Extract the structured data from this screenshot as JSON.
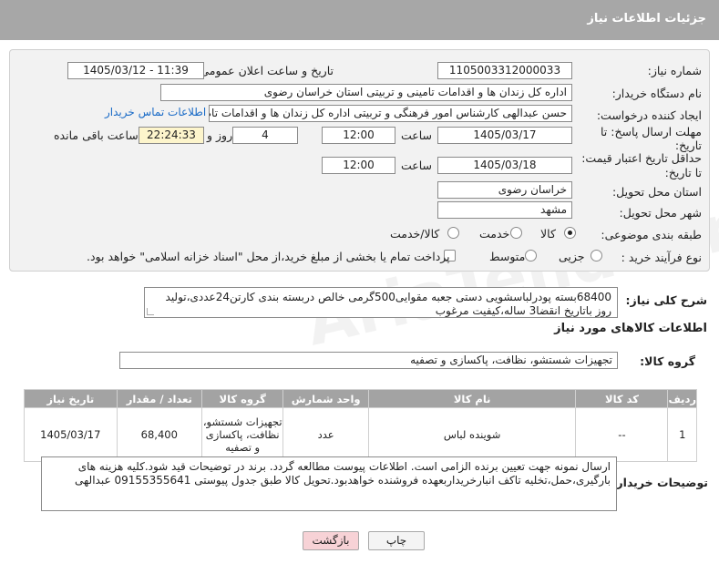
{
  "header": {
    "title": "جزئیات اطلاعات نیاز"
  },
  "form": {
    "need_number_label": "شماره نیاز:",
    "need_number": "1105003312000033",
    "announce_label": "تاریخ و ساعت اعلان عمومی:",
    "announce_value": "1405/03/12 - 11:39",
    "buyer_org_label": "نام دستگاه خریدار:",
    "buyer_org": "اداره کل زندان ها و اقدامات تامینی و تربیتی استان خراسان رضوی",
    "requester_label": "ایجاد کننده درخواست:",
    "requester": "حسن عبدالهی کارشناس امور فرهنگی و تربیتی اداره کل زندان ها و اقدامات تام",
    "contact_link": "اطلاعات تماس خریدار",
    "deadline_label_1": "مهلت ارسال پاسخ: تا",
    "deadline_label_2": "تاریخ:",
    "deadline_date": "1405/03/17",
    "time_label": "ساعت",
    "deadline_time": "12:00",
    "days_value": "4",
    "days_label": "روز و",
    "remaining_time": "22:24:33",
    "remaining_label": "ساعت باقی مانده",
    "validity_label_1": "حداقل تاریخ اعتبار قیمت:",
    "validity_label_2": "تا تاریخ:",
    "validity_date": "1405/03/18",
    "validity_time": "12:00",
    "province_label": "استان محل تحویل:",
    "province": "خراسان رضوی",
    "city_label": "شهر محل تحویل:",
    "city": "مشهد",
    "category_label": "طبقه بندی موضوعی:",
    "category_options": [
      "کالا",
      "خدمت",
      "کالا/خدمت"
    ],
    "category_selected": "کالا",
    "process_label": "نوع فرآیند خرید :",
    "process_options": [
      "جزیی",
      "متوسط"
    ],
    "process_selected": "",
    "payment_note": "پرداخت تمام یا بخشی از مبلغ خرید،از محل \"اسناد خزانه اسلامی\" خواهد بود."
  },
  "description": {
    "label": "شرح کلی نیاز:",
    "text": "68400بسته پودرلباسشویی دستی جعبه مقوایی500گرمی خالص دربسته بندی کارتن24عددی،تولید روز باتاریخ انقضا3 ساله،کیفیت مرغوب"
  },
  "goods_section": {
    "title": "اطلاعات کالاهای مورد نیاز",
    "group_label": "گروه کالا:",
    "group_value": "تجهیزات شستشو، نظافت، پاکسازی و تصفیه"
  },
  "table": {
    "headers": [
      "ردیف",
      "کد کالا",
      "نام کالا",
      "واحد شمارش",
      "گروه کالا",
      "تعداد / مقدار",
      "تاریخ نیاز"
    ],
    "rows": [
      [
        "1",
        "--",
        "شوینده لباس",
        "عدد",
        "تجهیزات شستشو، نظافت، پاکسازی و تصفیه",
        "68,400",
        "1405/03/17"
      ]
    ]
  },
  "buyer_notes": {
    "label": "توضیحات خریدار:",
    "text": "ارسال نمونه جهت تعیین برنده الزامی است. اطلاعات پیوست مطالعه گردد. برند در توضیحات قید شود.کلیه هزینه های بارگیری،حمل،تخلیه تاکف انبارخریداربعهده فروشنده خواهدبود.تحویل کالا طبق جدول پیوستی 09155355641 عبدالهی"
  },
  "buttons": {
    "print": "چاپ",
    "back": "بازگشت"
  },
  "watermark": "AriaTender.net",
  "colors": {
    "header_bg": "#a7a7a7",
    "panel_bg": "#f2f2f2",
    "link": "#1a6bc7",
    "remaining_bg": "#fdf5cc",
    "back_bg": "#f7d2d6"
  }
}
